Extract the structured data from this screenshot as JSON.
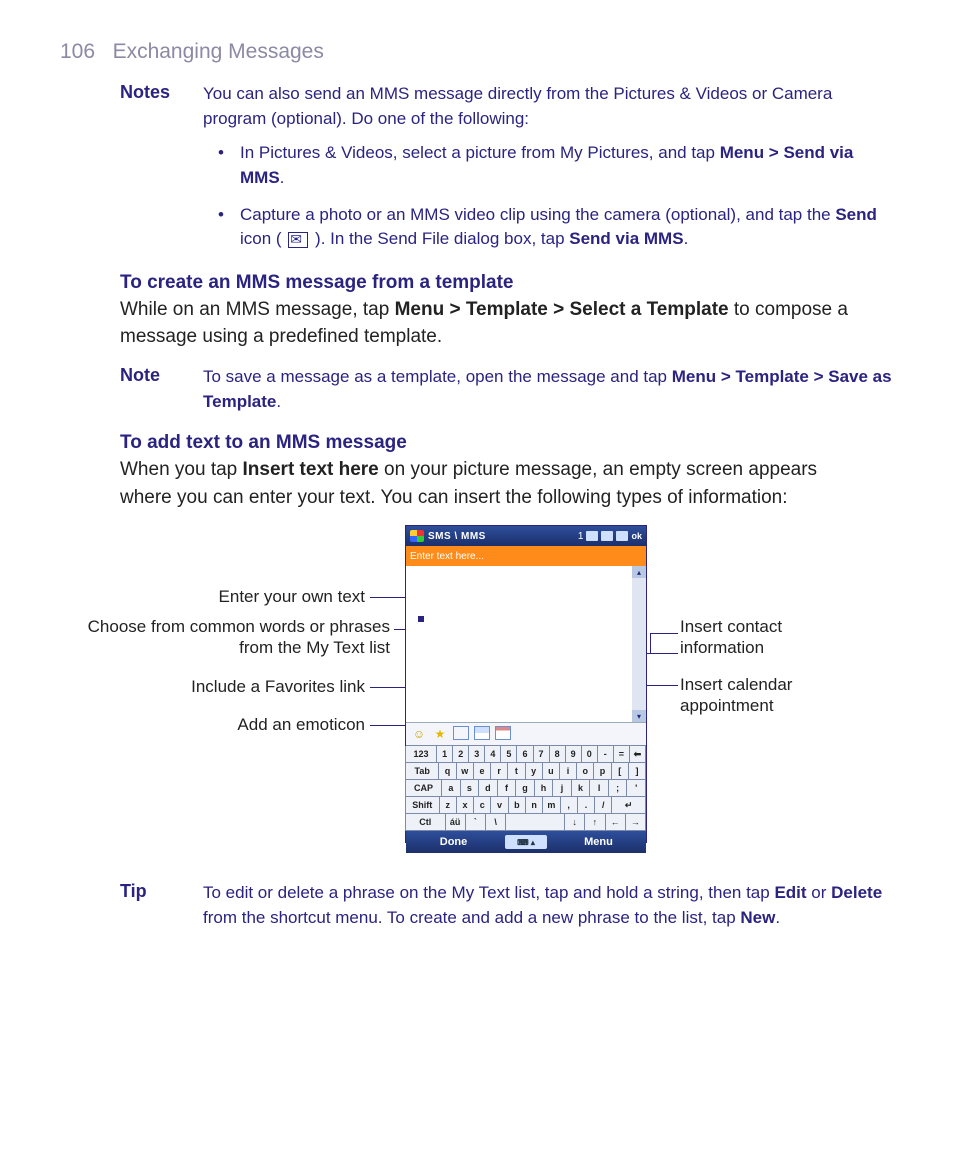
{
  "header": {
    "page_number": "106",
    "chapter": "Exchanging Messages"
  },
  "notes1": {
    "label": "Notes",
    "text": "You can also send an MMS message directly from the Pictures & Videos or Camera program (optional). Do one of the following:"
  },
  "bullets1": {
    "a_pre": "In Pictures & Videos, select a picture from My Pictures, and tap ",
    "a_bold": "Menu > Send via MMS",
    "b_pre": "Capture a photo or an MMS video clip using the camera (optional), and tap the ",
    "b_bold1": "Send",
    "b_mid": " icon ( ",
    "b_post": " ). In the Send File dialog box, tap ",
    "b_bold2": "Send via MMS"
  },
  "section_template": {
    "heading": "To create an MMS message from a template",
    "p_pre": "While on an MMS message, tap ",
    "p_bold": "Menu > Template > Select a Template",
    "p_post": " to compose a message using a predefined template."
  },
  "note2": {
    "label": "Note",
    "pre": "To save a message as a template, open the message and tap ",
    "bold": "Menu > Template > Save as Template"
  },
  "section_addtext": {
    "heading": "To add text to an MMS message",
    "p_pre": "When you tap ",
    "p_bold": "Insert text here",
    "p_post": " on your picture message, an empty screen appears where you can enter your text. You can insert the following types of information:"
  },
  "figure": {
    "left1": "Enter your own text",
    "left2": "Choose from common words or phrases from the My Text list",
    "left3": "Include a Favorites link",
    "left4": "Add an emoticon",
    "right1": "Insert contact information",
    "right2": "Insert calendar appointment"
  },
  "phone": {
    "title": "SMS \\ MMS",
    "count": "1",
    "ok": "ok",
    "enter_text": "Enter text here...",
    "done": "Done",
    "menu": "Menu",
    "kbd": {
      "r1": [
        "123",
        "1",
        "2",
        "3",
        "4",
        "5",
        "6",
        "7",
        "8",
        "9",
        "0",
        "-",
        "=",
        "⬅"
      ],
      "r2": [
        "Tab",
        "q",
        "w",
        "e",
        "r",
        "t",
        "y",
        "u",
        "i",
        "o",
        "p",
        "[",
        "]"
      ],
      "r3": [
        "CAP",
        "a",
        "s",
        "d",
        "f",
        "g",
        "h",
        "j",
        "k",
        "l",
        ";",
        "'"
      ],
      "r4": [
        "Shift",
        "z",
        "x",
        "c",
        "v",
        "b",
        "n",
        "m",
        ",",
        ".",
        "/",
        "↵"
      ],
      "r5": [
        "Ctl",
        "áü",
        "`",
        "\\",
        " ",
        "↓",
        "↑",
        "←",
        "→"
      ]
    }
  },
  "tip": {
    "label": "Tip",
    "pre": "To edit or delete a phrase on the My Text list, tap and hold a string, then tap ",
    "bold1": "Edit",
    "mid1": " or ",
    "bold2": "Delete",
    "mid2": " from the shortcut menu. To create and add a new phrase to the list, tap ",
    "bold3": "New"
  }
}
